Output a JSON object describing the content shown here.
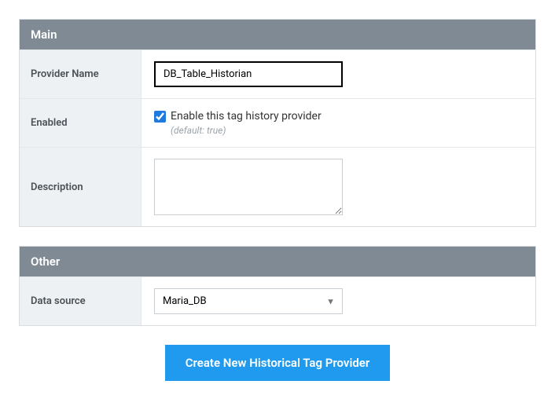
{
  "main": {
    "title": "Main",
    "provider_name": {
      "label": "Provider Name",
      "value": "DB_Table_Historian"
    },
    "enabled": {
      "label": "Enabled",
      "checkbox_label": "Enable this tag history provider",
      "hint": "(default: true)",
      "checked": true
    },
    "description": {
      "label": "Description",
      "value": ""
    }
  },
  "other": {
    "title": "Other",
    "data_source": {
      "label": "Data source",
      "value": "Maria_DB"
    }
  },
  "submit_label": "Create New Historical Tag Provider"
}
